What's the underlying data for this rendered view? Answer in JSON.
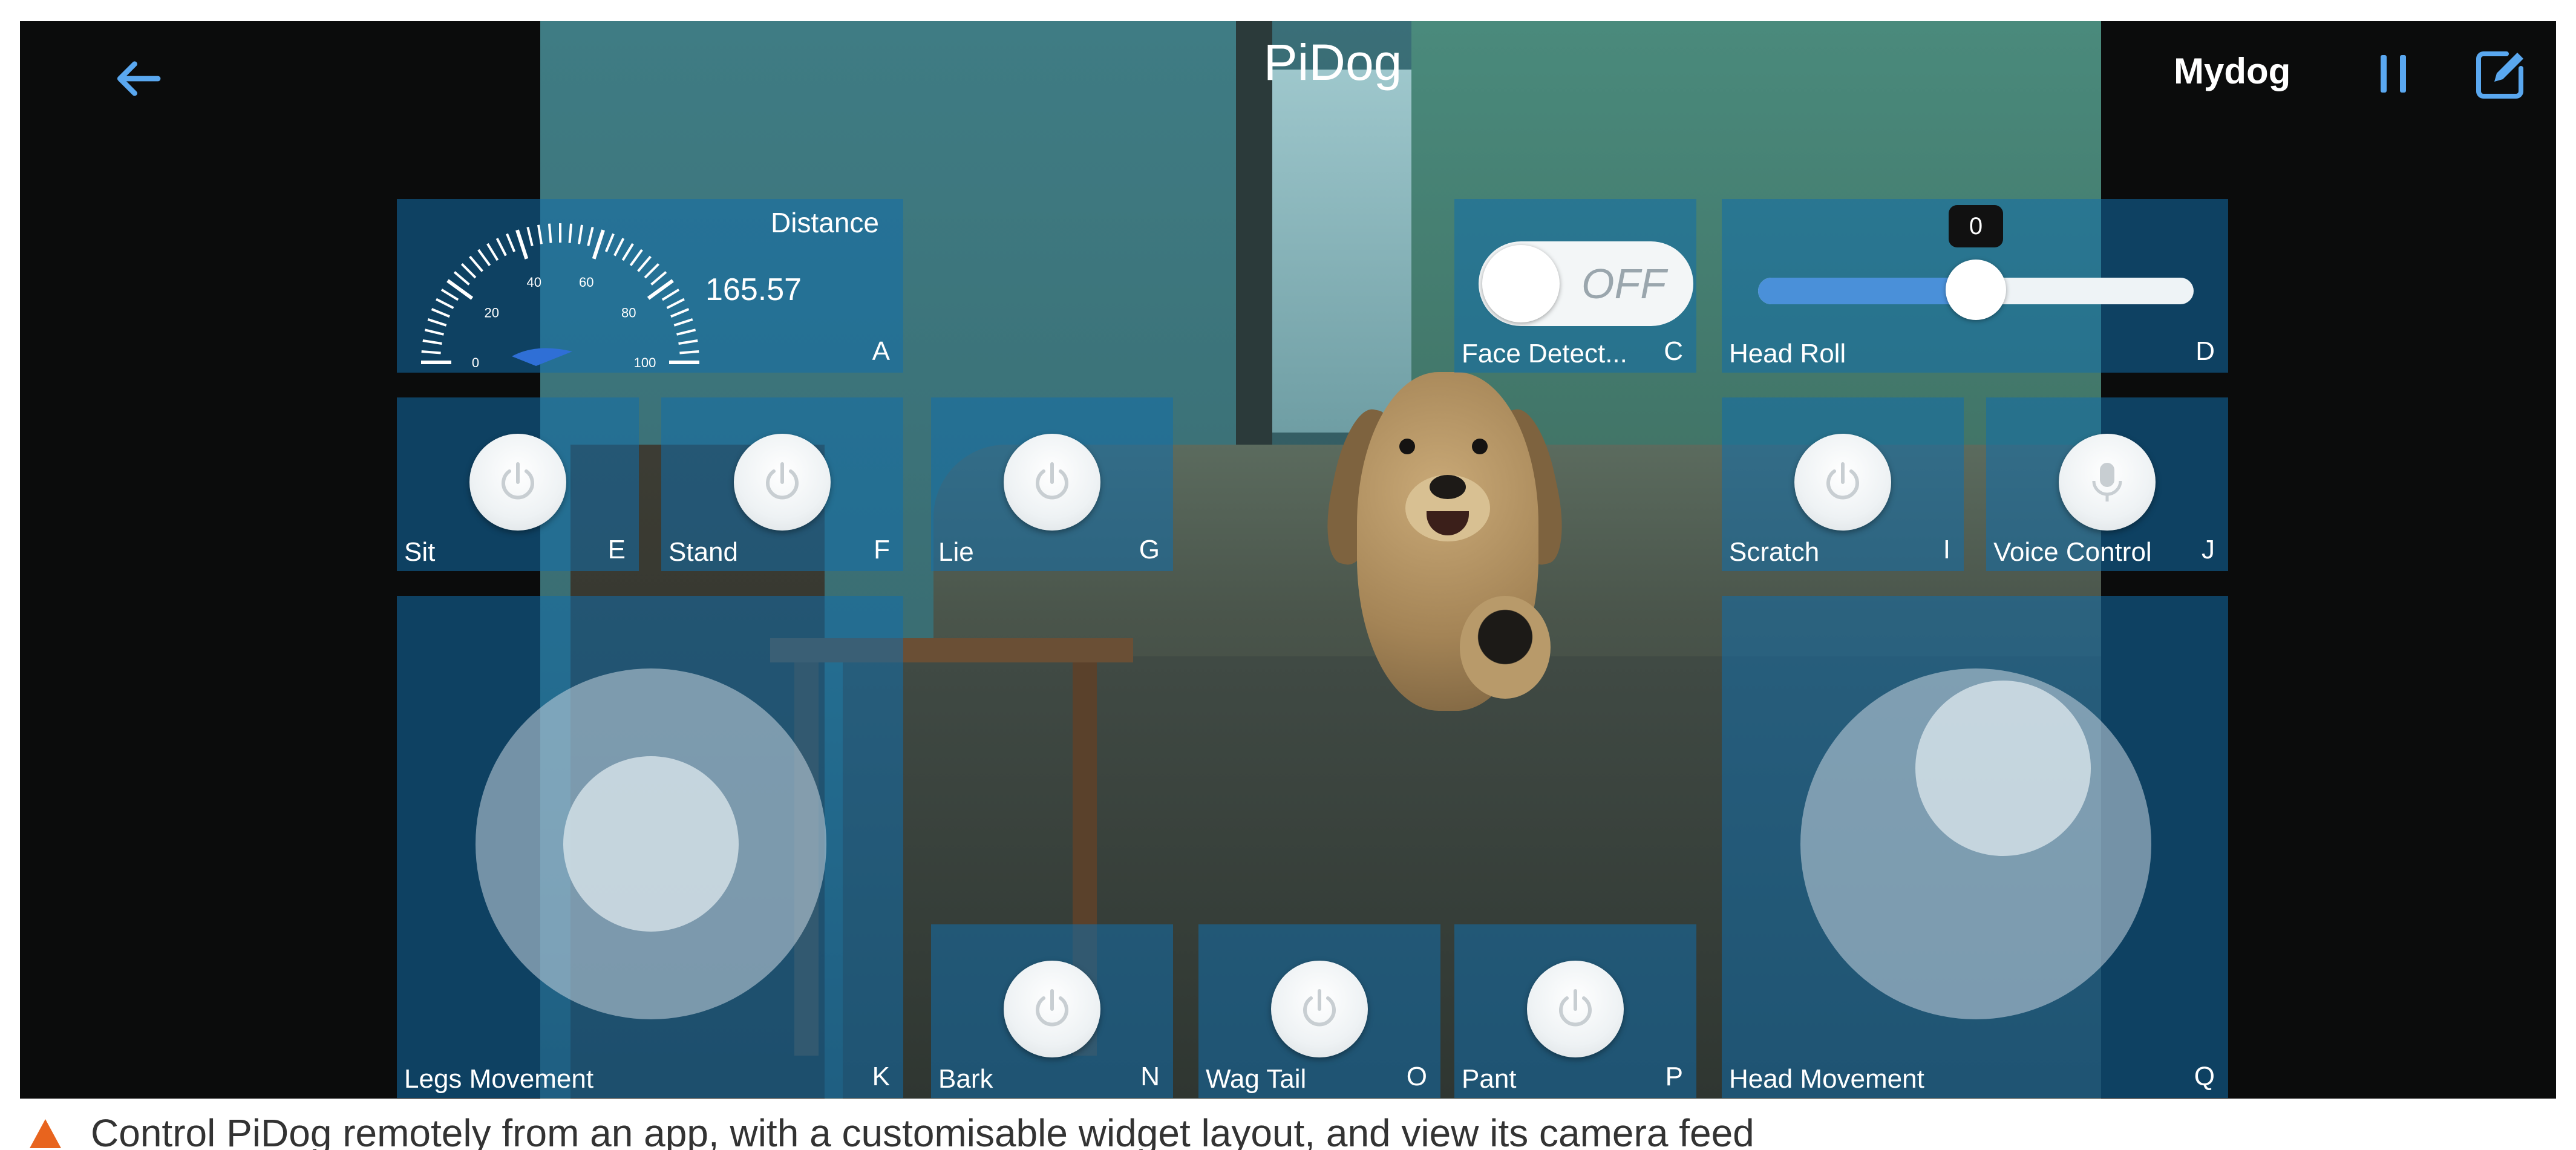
{
  "header": {
    "title": "PiDog",
    "profile": "Mydog",
    "back_icon": "arrow-left-icon",
    "pause_icon": "pause-icon",
    "edit_icon": "edit-icon"
  },
  "widgets": {
    "distance": {
      "title": "Distance",
      "value": "165.57",
      "key": "A",
      "ticks": [
        "0",
        "20",
        "40",
        "60",
        "80",
        "100"
      ]
    },
    "face_detect": {
      "label": "Face Detect...",
      "key": "C",
      "state": "OFF"
    },
    "head_roll": {
      "label": "Head Roll",
      "key": "D",
      "value": "0",
      "level": 0.5
    },
    "sit": {
      "label": "Sit",
      "key": "E"
    },
    "stand": {
      "label": "Stand",
      "key": "F"
    },
    "lie": {
      "label": "Lie",
      "key": "G"
    },
    "scratch": {
      "label": "Scratch",
      "key": "I"
    },
    "voice_control": {
      "label": "Voice Control",
      "key": "J"
    },
    "legs_movement": {
      "label": "Legs Movement",
      "key": "K"
    },
    "bark": {
      "label": "Bark",
      "key": "N"
    },
    "wag_tail": {
      "label": "Wag Tail",
      "key": "O"
    },
    "pant": {
      "label": "Pant",
      "key": "P"
    },
    "head_movement": {
      "label": "Head Movement",
      "key": "Q"
    }
  },
  "caption": {
    "icon": "triangle-icon",
    "text": "Control PiDog remotely from an app, with a customisable widget layout, and view its camera feed"
  },
  "colors": {
    "tile": "#126eaa",
    "accent": "#4a90d9",
    "caption_triangle": "#e8641e"
  }
}
